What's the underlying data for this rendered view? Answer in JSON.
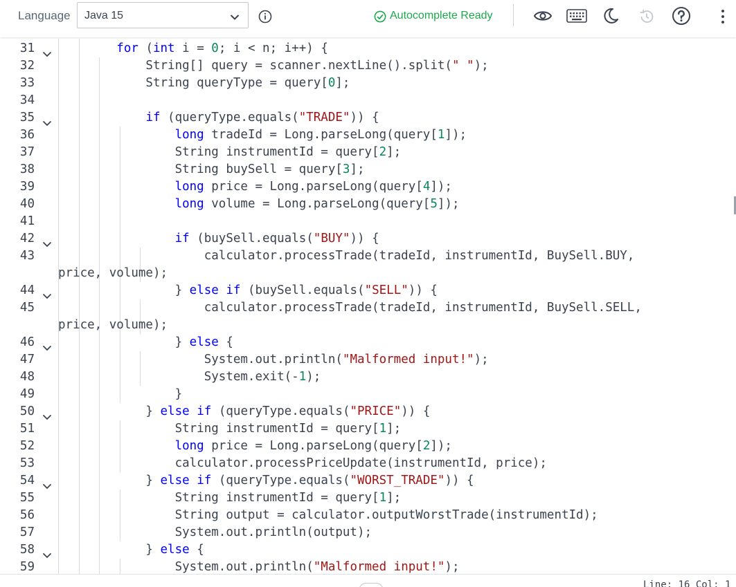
{
  "toolbar": {
    "language_label": "Language",
    "language_value": "Java 15",
    "autocomplete_status": "Autocomplete Ready",
    "icons": [
      "chevron-down-icon",
      "info-icon",
      "check-circle-icon",
      "eye-icon",
      "keyboard-icon",
      "moon-icon",
      "history-icon",
      "help-icon",
      "more-vertical-icon"
    ],
    "colors": {
      "status_green": "#1ba94c",
      "keyword_blue": "#0000ff",
      "number_green": "#098658",
      "string_red": "#a31515",
      "text": "#39424e"
    }
  },
  "editor": {
    "lines": [
      {
        "num": "31",
        "fold": true,
        "code": "        for (int i = 0; i < n; i++) {"
      },
      {
        "num": "32",
        "fold": false,
        "code": "            String[] query = scanner.nextLine().split(\" \");"
      },
      {
        "num": "33",
        "fold": false,
        "code": "            String queryType = query[0];"
      },
      {
        "num": "34",
        "fold": false,
        "code": ""
      },
      {
        "num": "35",
        "fold": true,
        "code": "            if (queryType.equals(\"TRADE\")) {"
      },
      {
        "num": "36",
        "fold": false,
        "code": "                long tradeId = Long.parseLong(query[1]);"
      },
      {
        "num": "37",
        "fold": false,
        "code": "                String instrumentId = query[2];"
      },
      {
        "num": "38",
        "fold": false,
        "code": "                String buySell = query[3];"
      },
      {
        "num": "39",
        "fold": false,
        "code": "                long price = Long.parseLong(query[4]);"
      },
      {
        "num": "40",
        "fold": false,
        "code": "                long volume = Long.parseLong(query[5]);"
      },
      {
        "num": "41",
        "fold": false,
        "code": ""
      },
      {
        "num": "42",
        "fold": true,
        "code": "                if (buySell.equals(\"BUY\")) {"
      },
      {
        "num": "43",
        "fold": false,
        "code": "                    calculator.processTrade(tradeId, instrumentId, BuySell.BUY,"
      },
      {
        "num": "",
        "fold": false,
        "code": "price, volume);"
      },
      {
        "num": "44",
        "fold": true,
        "code": "                } else if (buySell.equals(\"SELL\")) {"
      },
      {
        "num": "45",
        "fold": false,
        "code": "                    calculator.processTrade(tradeId, instrumentId, BuySell.SELL,"
      },
      {
        "num": "",
        "fold": false,
        "code": "price, volume);"
      },
      {
        "num": "46",
        "fold": true,
        "code": "                } else {"
      },
      {
        "num": "47",
        "fold": false,
        "code": "                    System.out.println(\"Malformed input!\");"
      },
      {
        "num": "48",
        "fold": false,
        "code": "                    System.exit(-1);"
      },
      {
        "num": "49",
        "fold": false,
        "code": "                }"
      },
      {
        "num": "50",
        "fold": true,
        "code": "            } else if (queryType.equals(\"PRICE\")) {"
      },
      {
        "num": "51",
        "fold": false,
        "code": "                String instrumentId = query[1];"
      },
      {
        "num": "52",
        "fold": false,
        "code": "                long price = Long.parseLong(query[2]);"
      },
      {
        "num": "53",
        "fold": false,
        "code": "                calculator.processPriceUpdate(instrumentId, price);"
      },
      {
        "num": "54",
        "fold": true,
        "code": "            } else if (queryType.equals(\"WORST_TRADE\")) {"
      },
      {
        "num": "55",
        "fold": false,
        "code": "                String instrumentId = query[1];"
      },
      {
        "num": "56",
        "fold": false,
        "code": "                String output = calculator.outputWorstTrade(instrumentId);"
      },
      {
        "num": "57",
        "fold": false,
        "code": "                System.out.println(output);"
      },
      {
        "num": "58",
        "fold": true,
        "code": "            } else {"
      },
      {
        "num": "59",
        "fold": false,
        "code": "                System.out.println(\"Malformed input!\");"
      }
    ]
  },
  "status": {
    "position": "Line: 16 Col: 1"
  }
}
